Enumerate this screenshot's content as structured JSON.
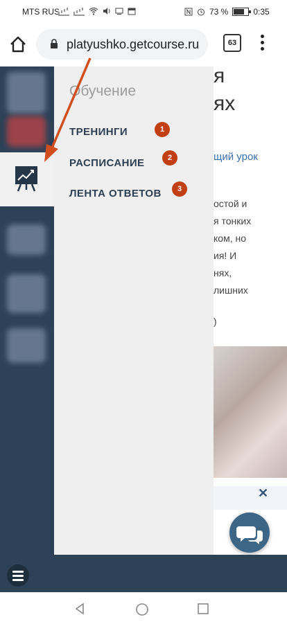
{
  "status_bar": {
    "carrier": "MTS RUS",
    "battery_text": "73 %",
    "time": "0:35"
  },
  "browser": {
    "url": "platyushko.getcourse.ru",
    "tab_count": "63"
  },
  "background_page": {
    "title_fragment": "я\nях",
    "link_fragment": "щий урок",
    "text_lines": [
      "остой и",
      "я тонких",
      "ком, но",
      "ия! И",
      "нях,",
      "лишних"
    ],
    "paren": ")"
  },
  "menu": {
    "heading": "Обучение",
    "items": [
      {
        "label": "ТРЕНИНГИ",
        "badge": "1"
      },
      {
        "label": "РАСПИСАНИЕ",
        "badge": "2"
      },
      {
        "label": "ЛЕНТА ОТВЕТОВ",
        "badge": "3"
      }
    ]
  },
  "colors": {
    "rail": "#2d4157",
    "badge": "#c23f13",
    "arrow": "#d24e1e",
    "chat": "#3d6686"
  }
}
